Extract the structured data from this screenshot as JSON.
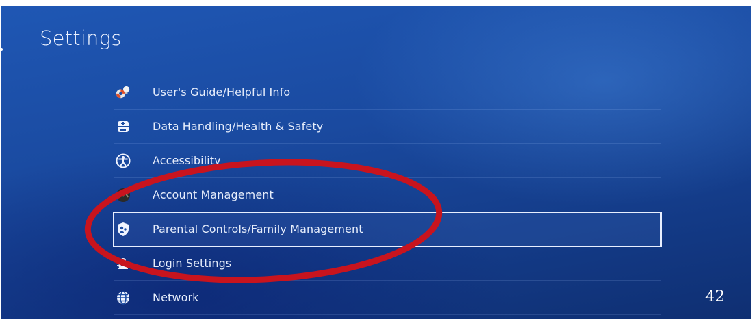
{
  "page": {
    "title": "Settings"
  },
  "menu": {
    "items": [
      {
        "label": "User's Guide/Helpful Info",
        "icon": "lifebuoy-lightbulb-icon"
      },
      {
        "label": "Data Handling/Health & Safety",
        "icon": "data-handling-icon"
      },
      {
        "label": "Accessibility",
        "icon": "accessibility-icon"
      },
      {
        "label": "Account Management",
        "icon": "account-management-icon"
      },
      {
        "label": "Parental Controls/Family Management",
        "icon": "parental-controls-shield-icon",
        "selected": true
      },
      {
        "label": "Login Settings",
        "icon": "login-settings-icon"
      },
      {
        "label": "Network",
        "icon": "globe-icon"
      }
    ]
  },
  "page_number": "42",
  "colors": {
    "background": "#1a4aa0",
    "text": "#e6edfb",
    "selection_outline": "#e8efff",
    "annotation_ellipse": "#c8141e"
  }
}
